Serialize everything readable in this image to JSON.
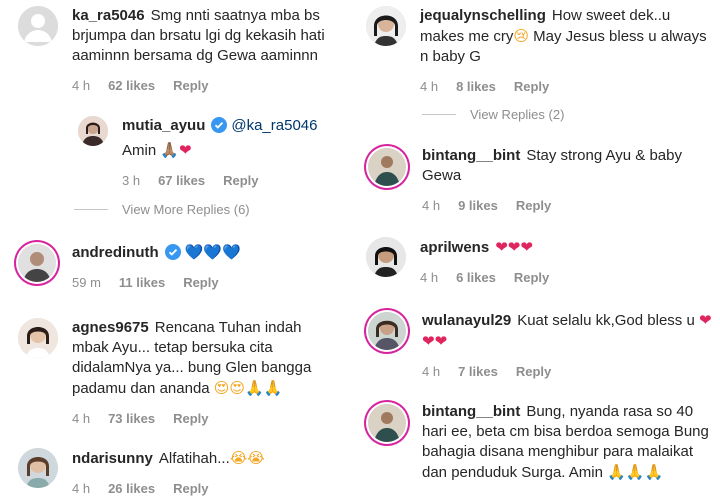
{
  "left": {
    "c1": {
      "user": "ka_ra5046",
      "text": "Smg nnti saatnya mba bs brjumpa dan brsatu lgi dg kekasih hati aaminnn bersama dg Gewa aaminnn",
      "time": "4 h",
      "likes": "62 likes",
      "reply": "Reply"
    },
    "c1r": {
      "user": "mutia_ayuu",
      "mention": "@ka_ra5046",
      "text": "Amin",
      "emoji": "🙏🏽❤",
      "time": "3 h",
      "likes": "67 likes",
      "reply": "Reply"
    },
    "more1": "View More Replies (6)",
    "c2": {
      "user": "andredinuth",
      "text": "💙💙💙",
      "time": "59 m",
      "likes": "11 likes",
      "reply": "Reply"
    },
    "c3": {
      "user": "agnes9675",
      "text": "Rencana Tuhan indah mbak Ayu... tetap bersuka cita didalamNya ya... bung Glen bangga padamu dan ananda",
      "emoji": "😍😍🙏🙏",
      "time": "4 h",
      "likes": "73 likes",
      "reply": "Reply"
    },
    "c4": {
      "user": "ndarisunny",
      "text": "Alfatihah...",
      "emoji": "😭😭",
      "time": "4 h",
      "likes": "26 likes",
      "reply": "Reply"
    }
  },
  "right": {
    "c1": {
      "user": "jequalynschelling",
      "text": "How sweet dek..u makes me cry",
      "emoji": "😢",
      "text2": "May Jesus bless u always n baby G",
      "time": "4 h",
      "likes": "8 likes",
      "reply": "Reply"
    },
    "more1": "View Replies (2)",
    "c2": {
      "user": "bintang__bint",
      "text": "Stay strong Ayu & baby Gewa",
      "time": "4 h",
      "likes": "9 likes",
      "reply": "Reply"
    },
    "c3": {
      "user": "aprilwens",
      "text": "❤❤❤",
      "time": "4 h",
      "likes": "6 likes",
      "reply": "Reply"
    },
    "c4": {
      "user": "wulanayul29",
      "text": "Kuat selalu kk,God bless u",
      "emoji": "❤❤❤",
      "time": "4 h",
      "likes": "7 likes",
      "reply": "Reply"
    },
    "c5": {
      "user": "bintang__bint",
      "text": "Bung, nyanda rasa so 40 hari ee, beta cm bisa berdoa semoga Bung bahagia disana menghibur para malaikat dan penduduk Surga. Amin",
      "emoji": "🙏🙏🙏"
    }
  },
  "colors": {
    "username": "#262626",
    "meta": "#8e8e8e",
    "mention": "#00376b",
    "verified": "#3897f0",
    "heart": "#e0245e",
    "story_ring": "#d6249f"
  }
}
